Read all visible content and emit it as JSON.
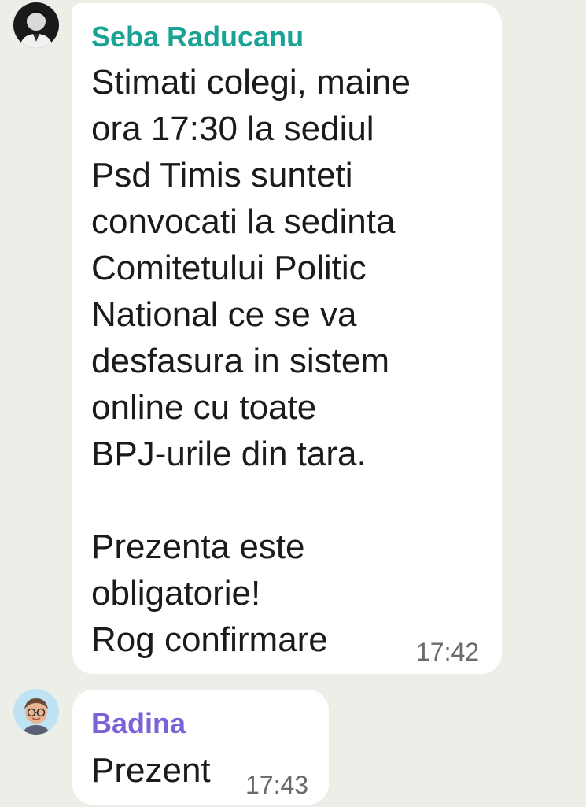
{
  "messages": [
    {
      "sender": "Seba Raducanu",
      "sender_color": "#1aa394",
      "avatar_icon": "man-photo-avatar",
      "text": "Stimati colegi, maine\nora 17:30 la sediul\nPsd Timis sunteti\nconvocati la sedinta\nComitetului Politic\nNational ce se va\ndesfasura in sistem\nonline cu toate\nBPJ-urile din tara.\n\nPrezenta este\nobligatorie!\nRog confirmare",
      "time": "17:42"
    },
    {
      "sender": "Badina",
      "sender_color": "#7b62d6",
      "avatar_icon": "memoji-avatar",
      "text": "Prezent",
      "time": "17:43"
    }
  ]
}
